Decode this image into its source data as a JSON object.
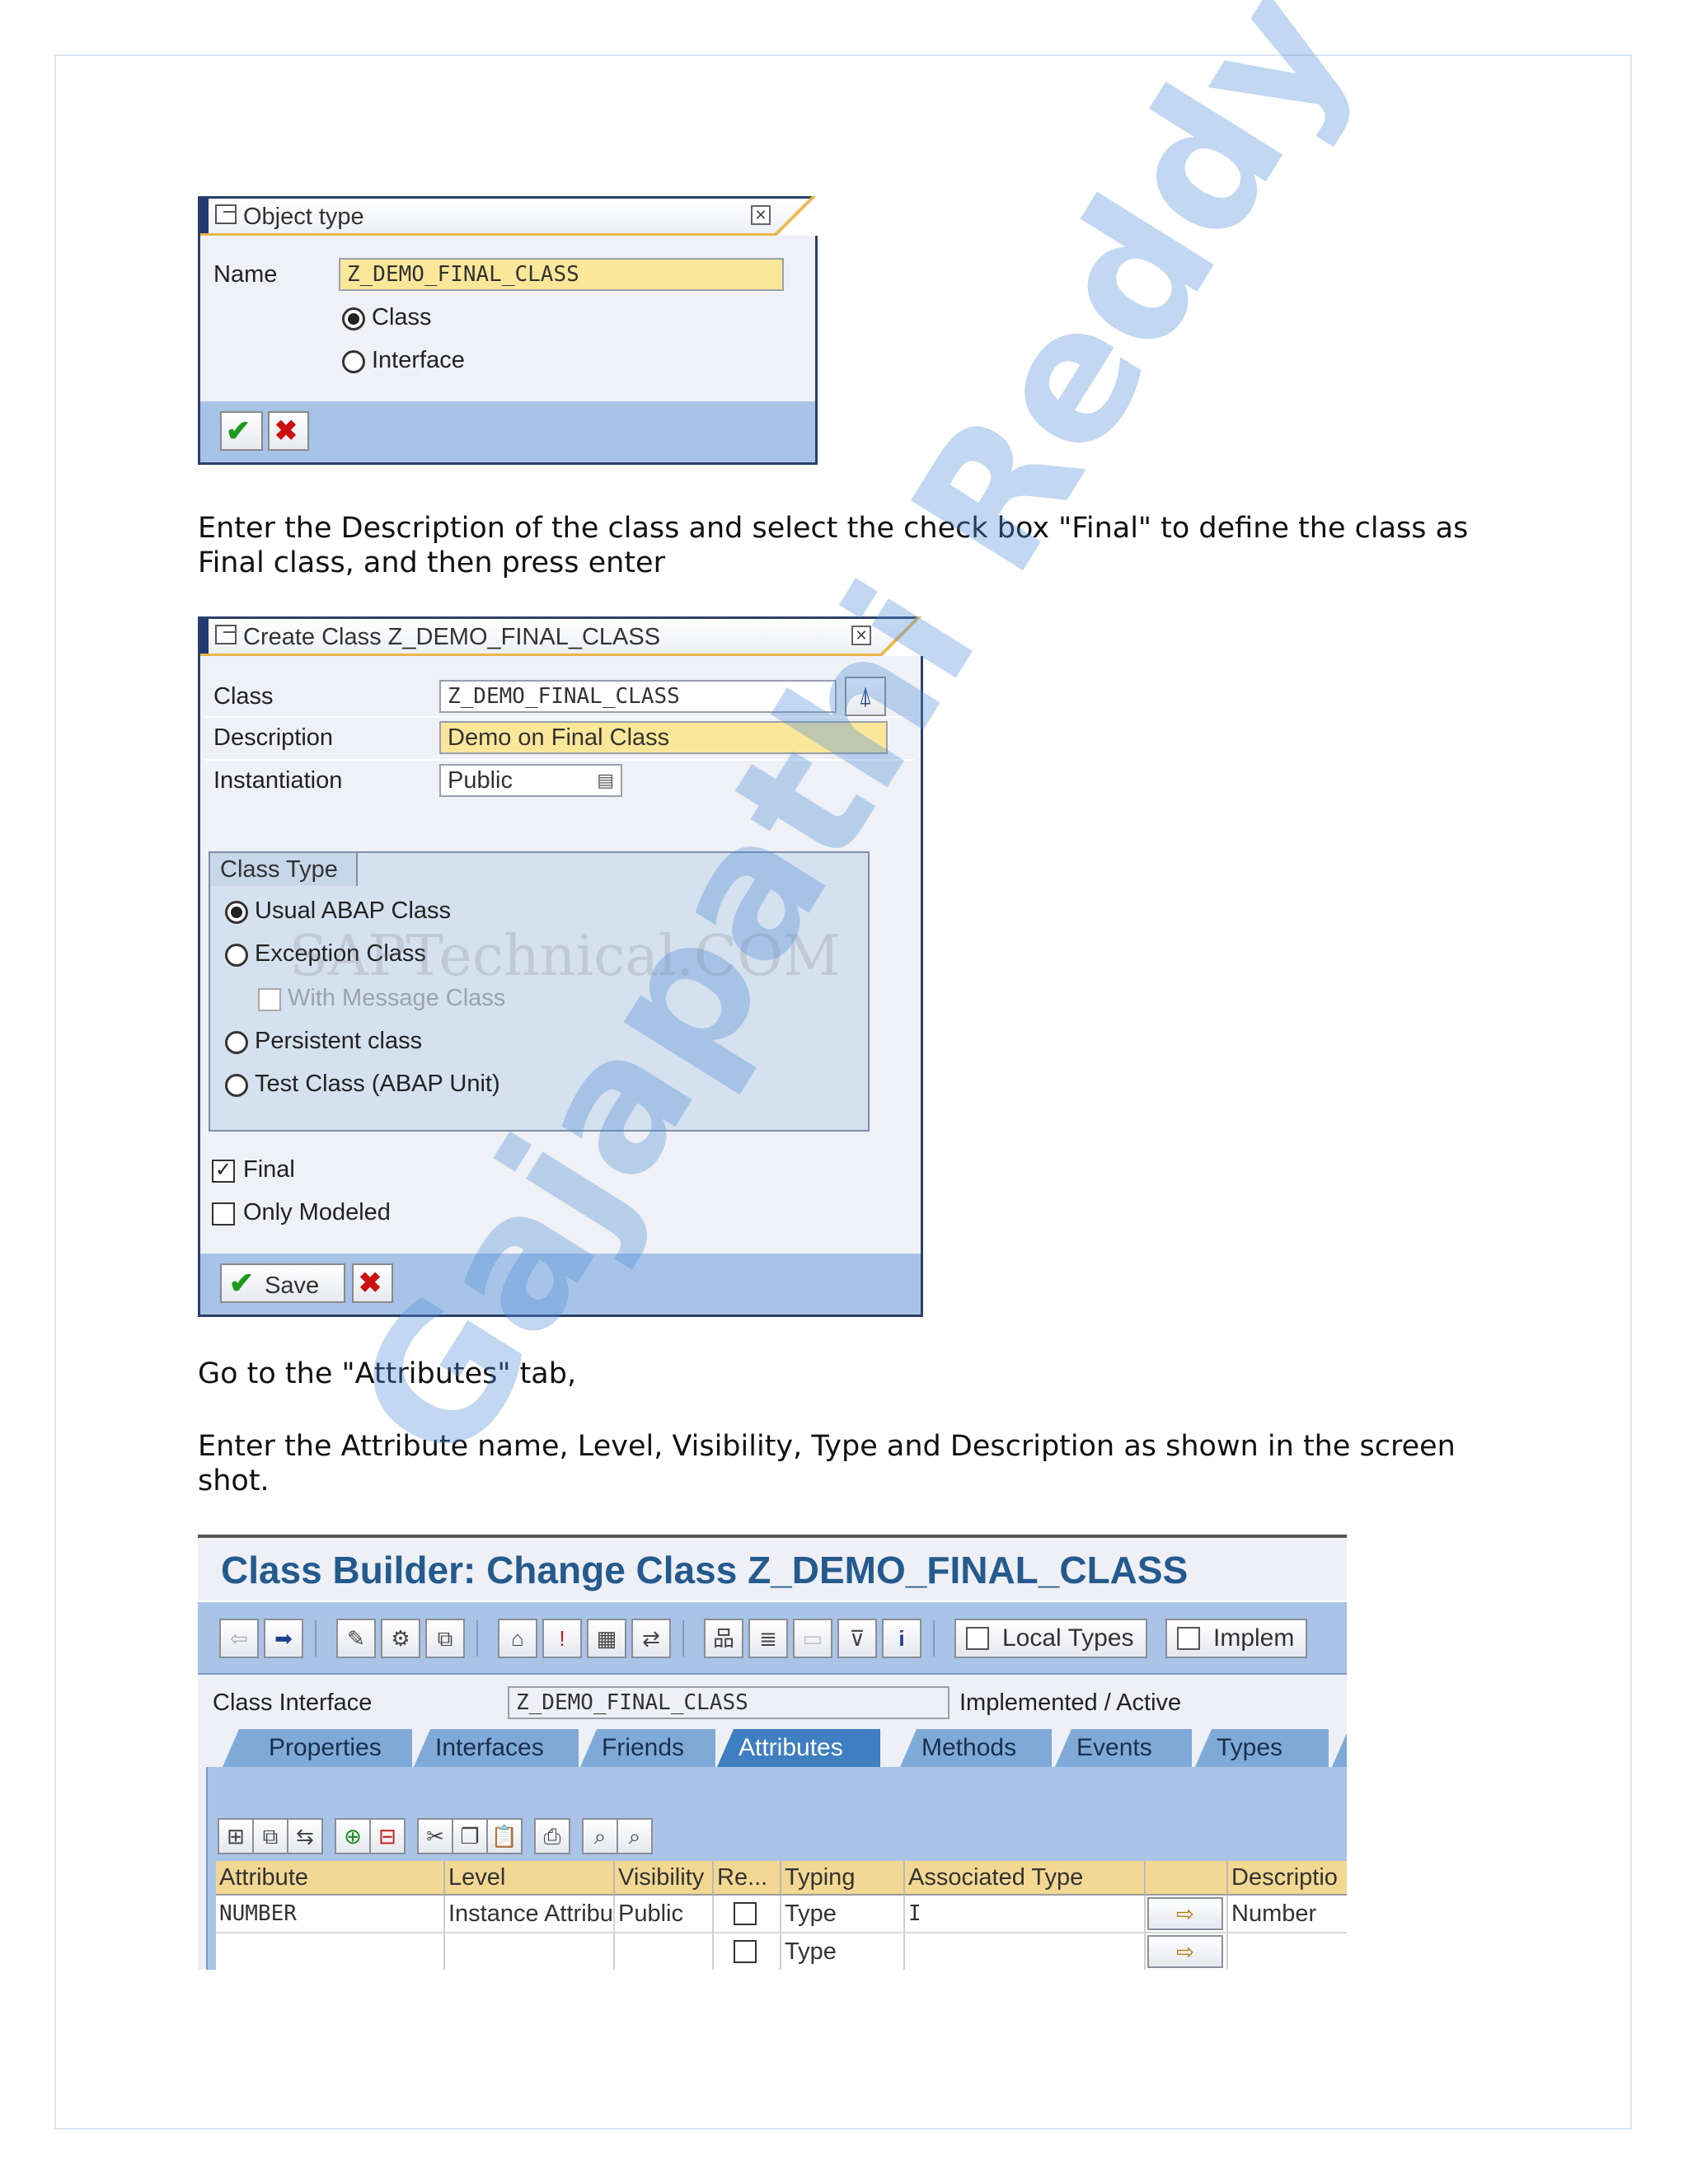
{
  "dialog1": {
    "title": "Object type",
    "name_label": "Name",
    "name_value": "Z_DEMO_FINAL_CLASS",
    "options": [
      "Class",
      "Interface"
    ],
    "selected_option": "Class"
  },
  "para1_line1": "Enter the Description of the class and select the check box \"Final\" to define the class as",
  "para1_line2": "Final class, and then press enter",
  "dialog2": {
    "title": "Create Class Z_DEMO_FINAL_CLASS",
    "class_label": "Class",
    "class_value": "Z_DEMO_FINAL_CLASS",
    "description_label": "Description",
    "description_value": "Demo on Final Class",
    "instantiation_label": "Instantiation",
    "instantiation_value": "Public",
    "class_type_label": "Class Type",
    "class_types": [
      "Usual ABAP Class",
      "Exception Class",
      "With Message Class",
      "Persistent class",
      "Test Class (ABAP Unit)"
    ],
    "selected_class_type": "Usual ABAP Class",
    "final_label": "Final",
    "final_checked": true,
    "only_modeled_label": "Only Modeled",
    "only_modeled_checked": false,
    "save_label": "Save"
  },
  "para2": "Go to the \"Attributes\" tab,",
  "para3_line1": "Enter the Attribute name, Level, Visibility, Type and Description as shown in the screen",
  "para3_line2": "shot.",
  "class_builder": {
    "title": "Class Builder: Change Class Z_DEMO_FINAL_CLASS",
    "local_types_label": "Local Types",
    "implem_label": "Implem",
    "class_interface_label": "Class Interface",
    "class_interface_value": "Z_DEMO_FINAL_CLASS",
    "status": "Implemented / Active",
    "tabs": [
      "Properties",
      "Interfaces",
      "Friends",
      "Attributes",
      "Methods",
      "Events",
      "Types"
    ],
    "active_tab": "Attributes",
    "columns": [
      "Attribute",
      "Level",
      "Visibility",
      "Re...",
      "Typing",
      "Associated Type",
      "",
      "Descriptio"
    ],
    "rows": [
      [
        "NUMBER",
        "Instance Attribu",
        "Public",
        "",
        "Type",
        "I",
        "",
        "Number"
      ],
      [
        "",
        "",
        "",
        "",
        "Type",
        "",
        "",
        ""
      ]
    ]
  },
  "watermarks": {
    "site": "SAPTechnical.COM",
    "author": "Gajapathi Reddy"
  }
}
